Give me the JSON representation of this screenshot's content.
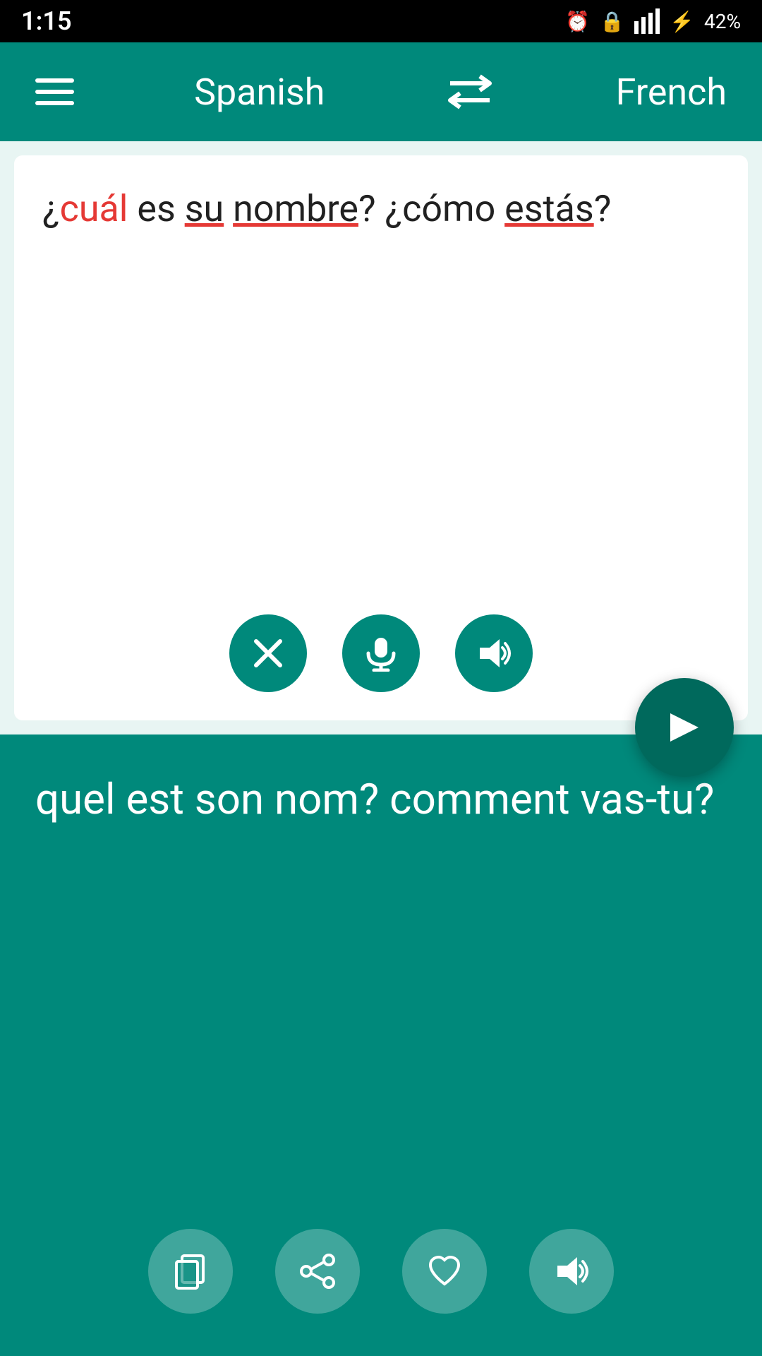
{
  "statusBar": {
    "time": "1:15",
    "battery": "42%"
  },
  "header": {
    "sourceLang": "Spanish",
    "targetLang": "French"
  },
  "inputArea": {
    "text": "¿cuál es su nombre? ¿cómo estás?",
    "clearLabel": "×",
    "micLabel": "mic",
    "speakerLabel": "speaker"
  },
  "outputArea": {
    "text": "quel est son nom? comment vas-tu?",
    "copyLabel": "copy",
    "shareLabel": "share",
    "favoriteLabel": "heart",
    "speakerLabel": "speaker"
  },
  "sendButton": "▶",
  "swapIcon": "⇄"
}
